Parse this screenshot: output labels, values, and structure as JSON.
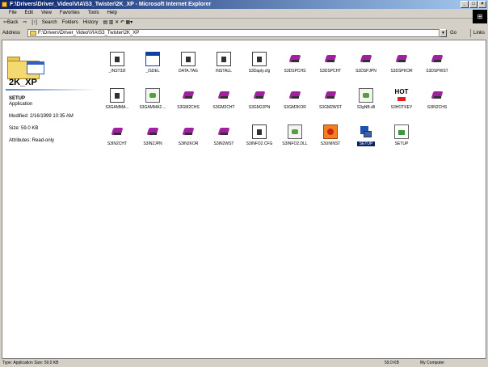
{
  "window": {
    "title": "F:\\Drivers\\Driver_Video\\VIA\\S3_Twister\\2K_XP - Microsoft Internet Explorer",
    "controls": [
      "_",
      "□",
      "×"
    ]
  },
  "menubar": [
    "File",
    "Edit",
    "View",
    "Favorites",
    "Tools",
    "Help"
  ],
  "toolbar": {
    "back": "⇦Back",
    "forward": "⇨",
    "up": "[↑]",
    "search": "Search",
    "folders": "Folders",
    "history": "History",
    "extra": "▤ ▥ ✕ ↶ ▦▾"
  },
  "addressbar": {
    "label": "Address",
    "value": "F:\\Drivers\\Driver_Video\\VIA\\S3_Twister\\2K_XP",
    "go": "Go",
    "links": "Links"
  },
  "leftpane": {
    "folder_name": "2K_XP",
    "selected_name": "SETUP",
    "selected_type": "Application",
    "modified": "Modified: 2/16/1999 10:35 AM",
    "size": "Size: 59.0 KB",
    "attributes": "Attributes: Read-only"
  },
  "files": [
    {
      "label": "_INST32I",
      "icon": "doc-icon"
    },
    {
      "label": "_ISDEL",
      "icon": "window-icon"
    },
    {
      "label": "DATA.TAG",
      "icon": "doc-icon"
    },
    {
      "label": "INSTALL",
      "icon": "doc-icon"
    },
    {
      "label": "S3Daply.cfg",
      "icon": "doc-icon"
    },
    {
      "label": "S3DSPCHS",
      "icon": "gem-icon"
    },
    {
      "label": "S3DSPCHT",
      "icon": "gem-icon"
    },
    {
      "label": "S3DSPJPN",
      "icon": "gem-icon"
    },
    {
      "label": "S3DSPKOR",
      "icon": "gem-icon"
    },
    {
      "label": "S3DSPWST",
      "icon": "gem-icon"
    },
    {
      "label": "S3GAMMA...",
      "icon": "doc-icon"
    },
    {
      "label": "S3GAMMA2....",
      "icon": "cfg-icon"
    },
    {
      "label": "S3GM2CHS",
      "icon": "gem-icon"
    },
    {
      "label": "S3GM2CHT",
      "icon": "gem-icon"
    },
    {
      "label": "S3GM2JPN",
      "icon": "gem-icon"
    },
    {
      "label": "S3GM2KOR",
      "icon": "gem-icon"
    },
    {
      "label": "S3GM2WST",
      "icon": "gem-icon"
    },
    {
      "label": "S3gNB.dll",
      "icon": "cfg-icon"
    },
    {
      "label": "S3HOTKEY",
      "icon": "hotkey-icon"
    },
    {
      "label": "S3IN2CHS",
      "icon": "gem-icon"
    },
    {
      "label": "S3IN2CHT",
      "icon": "gem-icon"
    },
    {
      "label": "S3IN2JPN",
      "icon": "gem-icon"
    },
    {
      "label": "S3IN2KOR",
      "icon": "gem-icon"
    },
    {
      "label": "S3IN2WST",
      "icon": "gem-icon"
    },
    {
      "label": "S3INFO2.CFG",
      "icon": "doc-icon"
    },
    {
      "label": "S3INFO2.DLL",
      "icon": "cfg-icon"
    },
    {
      "label": "S3UNINST",
      "icon": "uninstall-icon"
    },
    {
      "label": "SETUP",
      "icon": "setup-icon",
      "selected": true
    },
    {
      "label": "SETUP",
      "icon": "setup-doc-icon"
    }
  ],
  "hot_text": "HOT",
  "statusbar": {
    "left": "Type: Application Size: 59.0 KB",
    "size": "59.0 KB",
    "zone": "My Computer"
  }
}
